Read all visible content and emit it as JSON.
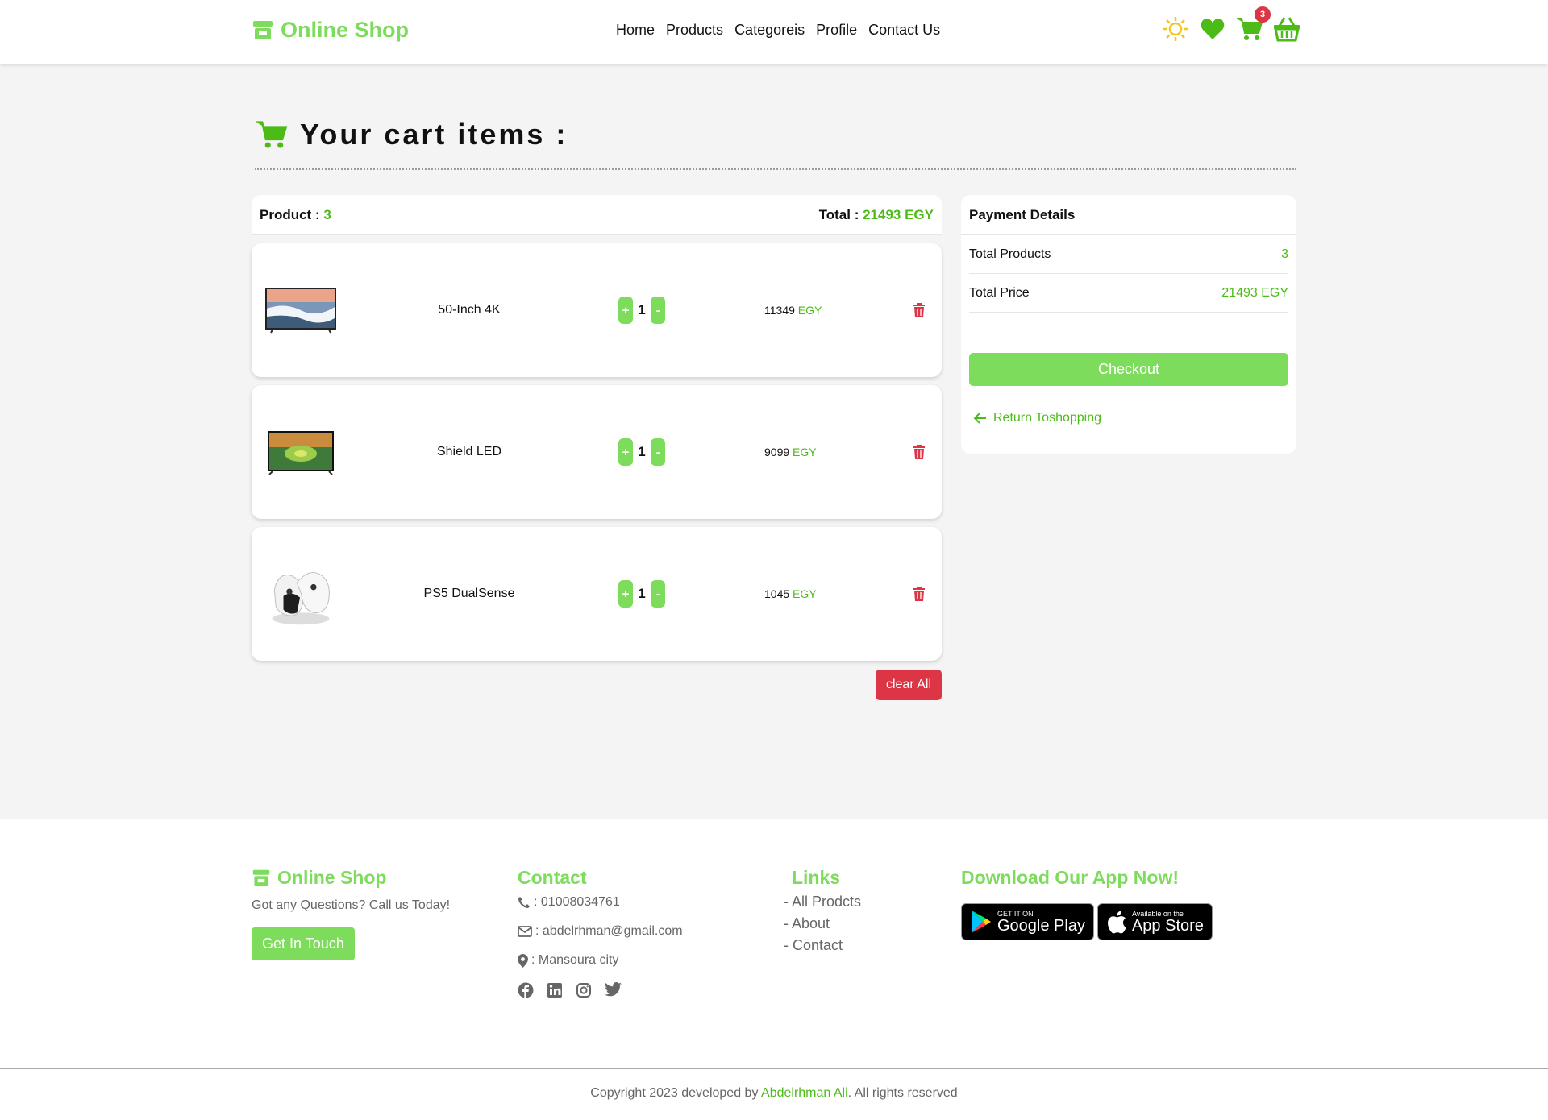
{
  "brand": {
    "name": "Online Shop",
    "icon": "store-icon",
    "color": "#7ddc5c"
  },
  "nav": {
    "links": [
      "Home",
      "Products",
      "Categoreis",
      "Profile",
      "Contact Us"
    ]
  },
  "nav_icons": {
    "theme": "sun-icon",
    "wishlist": "heart-icon",
    "cart": "cart-icon",
    "cart_count": "3",
    "basket": "basket-icon"
  },
  "page": {
    "title": "Your cart items :",
    "title_icon": "cart-icon"
  },
  "cart": {
    "product_label": "Product :",
    "product_count": "3",
    "total_label": "Total :",
    "total_value": "21493 EGY",
    "items": [
      {
        "name": "50-Inch 4K",
        "qty": "1",
        "price": "11349",
        "currency": "EGY",
        "image": "tv-4k-image"
      },
      {
        "name": "Shield LED",
        "qty": "1",
        "price": "9099",
        "currency": "EGY",
        "image": "tv-led-image"
      },
      {
        "name": "PS5 DualSense",
        "qty": "1",
        "price": "1045",
        "currency": "EGY",
        "image": "controller-image"
      }
    ],
    "plus": "+",
    "minus": "-",
    "clear_label": "clear All"
  },
  "payment": {
    "title": "Payment Details",
    "total_products_label": "Total Products",
    "total_products_value": "3",
    "total_price_label": "Total Price",
    "total_price_value": "21493 EGY",
    "checkout_label": "Checkout",
    "return_label": "Return Toshopping"
  },
  "footer": {
    "brand": "Online Shop",
    "tagline": "Got any Questions? Call us Today!",
    "touch_label": "Get In Touch",
    "contact_title": "Contact",
    "phone": ": 01008034761",
    "email": ": abdelrhman@gmail.com",
    "location": ": Mansoura city",
    "links_title": "Links",
    "links": [
      "- All Prodcts",
      "- About",
      "- Contact"
    ],
    "app_title": "Download Our App Now!",
    "google_small": "GET IT ON",
    "google_big": "Google Play",
    "apple_small": "Available on the",
    "apple_big": "App Store",
    "copyright_pre": "Copyright 2023 developed by",
    "copyright_name": "Abdelrhman Ali",
    "copyright_post": ". All rights reserved"
  },
  "colors": {
    "accent": "#7ddc5c",
    "accent_dark": "#4cbb17",
    "danger": "#dc3545",
    "sun": "#f5c518"
  }
}
